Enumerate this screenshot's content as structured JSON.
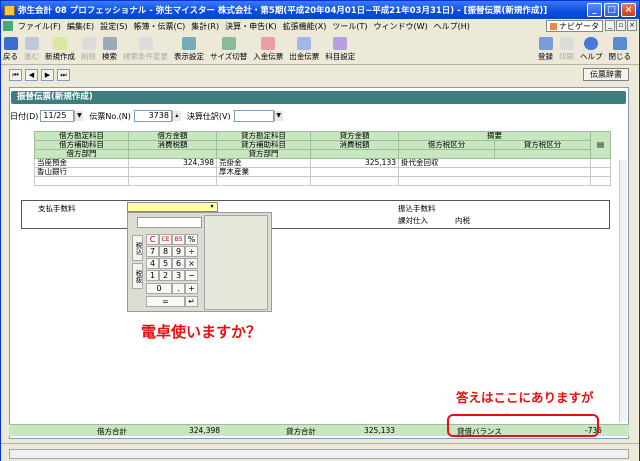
{
  "window": {
    "title": "弥生会計 08 プロフェッショナル - 弥生マイスター 株式会社・第5期(平成20年04月01日~平成21年03月31日) - [振替伝票(新規作成)]"
  },
  "menu": [
    "ファイル(F)",
    "編集(E)",
    "設定(S)",
    "帳簿・伝票(C)",
    "集計(R)",
    "決算・申告(K)",
    "拡張機能(X)",
    "ツール(T)",
    "ウィンドウ(W)",
    "ヘルプ(H)"
  ],
  "navi_label": "ナビゲータ",
  "toolbar": {
    "left": [
      {
        "label": "戻る",
        "icon": "back-arrow-icon",
        "enabled": true
      },
      {
        "label": "進む",
        "icon": "forward-arrow-icon",
        "enabled": false
      },
      {
        "label": "新規作成",
        "icon": "new-document-icon",
        "enabled": true
      },
      {
        "label": "削除",
        "icon": "delete-icon",
        "enabled": false
      },
      {
        "label": "検索",
        "icon": "search-icon",
        "enabled": true
      },
      {
        "label": "検索条件変更",
        "icon": "search-options-icon",
        "enabled": false
      },
      {
        "label": "表示設定",
        "icon": "display-settings-icon",
        "enabled": true
      },
      {
        "label": "サイズ切替",
        "icon": "resize-icon",
        "enabled": true
      },
      {
        "label": "入金伝票",
        "icon": "deposit-slip-icon",
        "enabled": true
      },
      {
        "label": "出金伝票",
        "icon": "withdrawal-slip-icon",
        "enabled": true
      },
      {
        "label": "科目設定",
        "icon": "account-settings-icon",
        "enabled": true
      }
    ],
    "right": [
      {
        "label": "登録",
        "icon": "register-icon",
        "enabled": true
      },
      {
        "label": "印刷",
        "icon": "print-icon",
        "enabled": false
      },
      {
        "label": "ヘルプ",
        "icon": "help-icon",
        "enabled": true
      },
      {
        "label": "閉じる",
        "icon": "close-door-icon",
        "enabled": true
      }
    ]
  },
  "history_button": "伝票辞書",
  "panel_title": "振替伝票(新規作成)",
  "params": {
    "date_label": "日付(D)",
    "date_value": "11/25",
    "slip_no_label": "伝票No.(N)",
    "slip_no_value": "3738",
    "settlement_label": "決算仕訳(V)",
    "settlement_value": ""
  },
  "grid_header": {
    "row1": [
      "借方勘定科目",
      "借方金額",
      "貸方勘定科目",
      "貸方金額",
      "摘要"
    ],
    "row2": [
      "借方補助科目",
      "消費税額",
      "貸方補助科目",
      "消費税額",
      "借方税区分",
      "貸方税区分"
    ],
    "row3": [
      "借方部門",
      "",
      "貸方部門"
    ]
  },
  "entries": [
    {
      "debit_account": "当座預金",
      "debit_amount": "324,398",
      "credit_account": "売掛金",
      "credit_amount": "325,133",
      "memo": "掛代金回収"
    },
    {
      "debit_account": "香山銀行",
      "debit_amount": "",
      "credit_account": "厚木産業",
      "credit_amount": "",
      "memo": ""
    }
  ],
  "active_row": {
    "debit_account": "支払手数料",
    "memo": "振込手数料",
    "tax_category": "課対仕入",
    "tax_type": "内税"
  },
  "calculator": {
    "side_keys": [
      "税込",
      "税抜"
    ],
    "rows": [
      [
        "C",
        "CE",
        "BS",
        "%"
      ],
      [
        "7",
        "8",
        "9",
        "÷"
      ],
      [
        "4",
        "5",
        "6",
        "×"
      ],
      [
        "1",
        "2",
        "3",
        "−"
      ],
      [
        "0",
        ".",
        "+"
      ],
      [
        "=",
        "↵"
      ]
    ]
  },
  "annotations": {
    "calc_question": "電卓使いますか？",
    "answer_here": "答えはここにありますが"
  },
  "totals": {
    "debit_label": "借方合計",
    "debit_value": "324,398",
    "credit_label": "貸方合計",
    "credit_value": "325,133",
    "balance_label": "貸借バランス",
    "balance_value": "-735"
  },
  "colors": {
    "header_green": "#c8e6c0",
    "panel_title": "#3e7d7d",
    "annotation_red": "#e81010",
    "titlebar": "#0a4be0"
  }
}
